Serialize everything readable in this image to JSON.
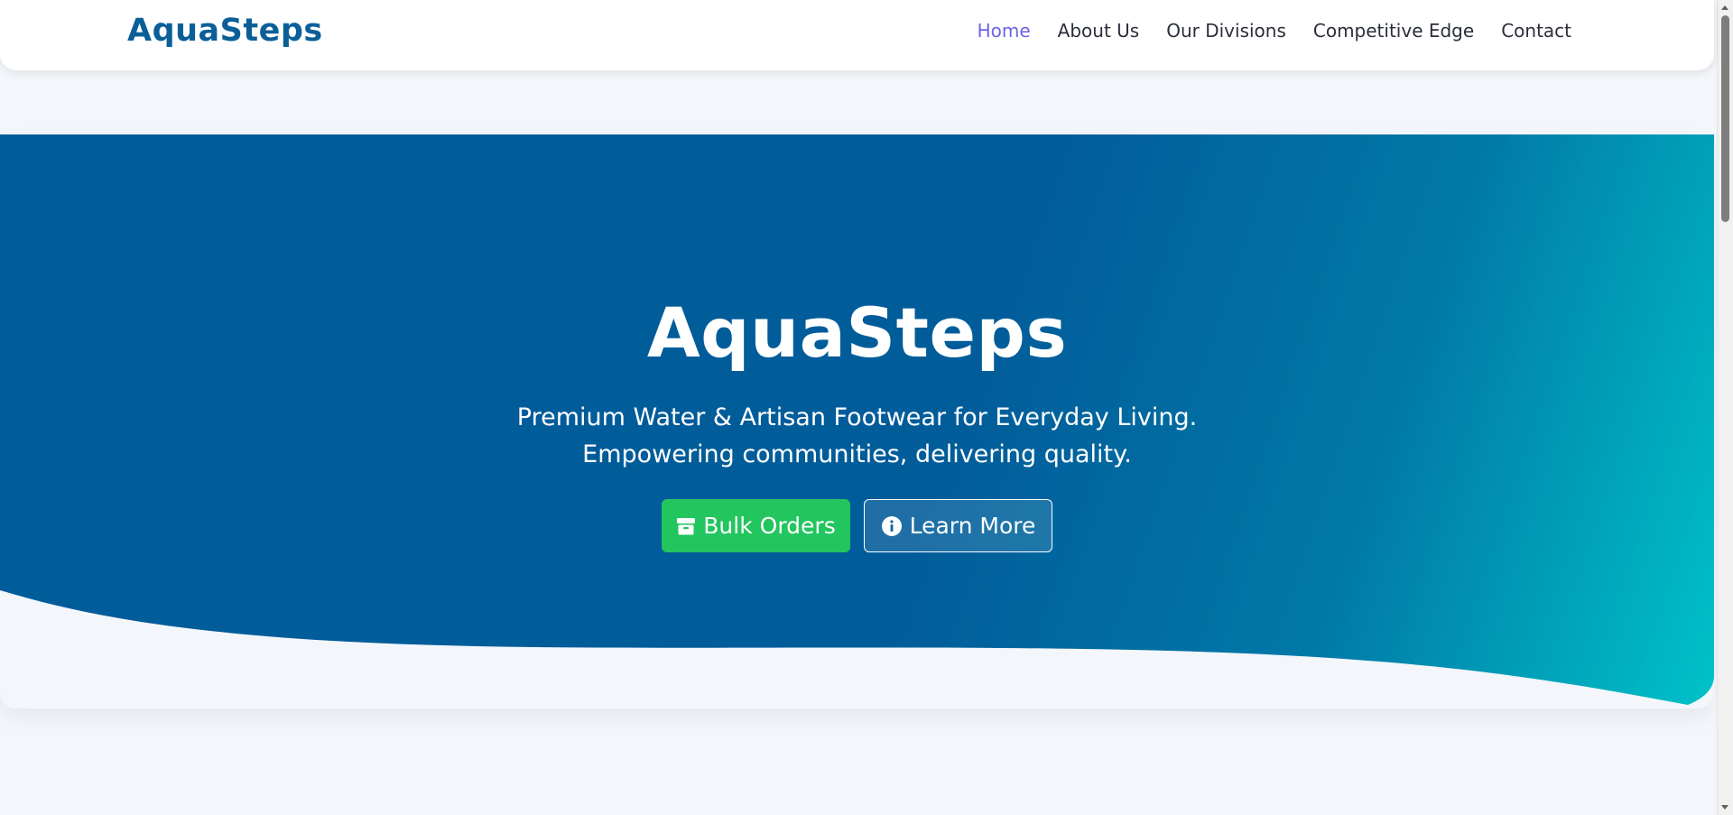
{
  "brand": {
    "logo_text": "AquaSteps",
    "primary_color": "#0b5f98",
    "accent_color": "#6c63e6"
  },
  "nav": {
    "items": [
      {
        "label": "Home",
        "active": true
      },
      {
        "label": "About Us",
        "active": false
      },
      {
        "label": "Our Divisions",
        "active": false
      },
      {
        "label": "Competitive Edge",
        "active": false
      },
      {
        "label": "Contact",
        "active": false
      }
    ]
  },
  "hero": {
    "title": "AquaSteps",
    "subtitle_line1": "Premium Water & Artisan Footwear for Everyday Living.",
    "subtitle_line2": "Empowering communities, delivering quality.",
    "gradient_start": "#015c9a",
    "gradient_end": "#00c2c8",
    "buttons": {
      "primary": {
        "label": "Bulk Orders",
        "icon": "box-icon",
        "color": "#22c55e"
      },
      "secondary": {
        "label": "Learn More",
        "icon": "info-circle-icon"
      }
    }
  }
}
